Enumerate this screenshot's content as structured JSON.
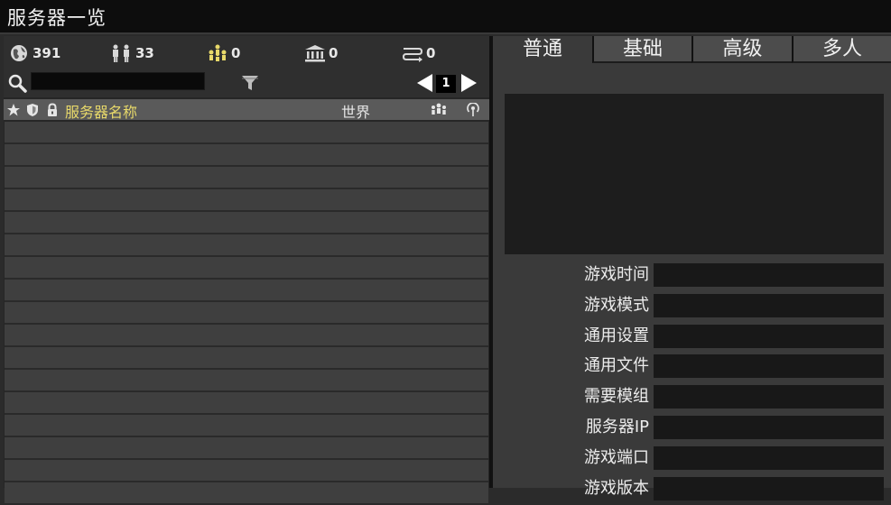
{
  "window": {
    "title": "服务器一览"
  },
  "stats": {
    "worlds": "391",
    "players": "33",
    "groups": "0",
    "buildings": "0",
    "links": "0"
  },
  "search": {
    "value": "",
    "placeholder": ""
  },
  "pager": {
    "page": "1"
  },
  "columns": {
    "name": "服务器名称",
    "world": "世界"
  },
  "server_rows": [
    "",
    "",
    "",
    "",
    "",
    "",
    "",
    "",
    "",
    "",
    "",
    "",
    "",
    "",
    "",
    "",
    ""
  ],
  "tabs": [
    {
      "label": "普通"
    },
    {
      "label": "基础"
    },
    {
      "label": "高级"
    },
    {
      "label": "多人"
    }
  ],
  "info": {
    "rows": [
      {
        "label": "游戏时间",
        "value": ""
      },
      {
        "label": "游戏模式",
        "value": ""
      },
      {
        "label": "通用设置",
        "value": ""
      },
      {
        "label": "通用文件",
        "value": ""
      },
      {
        "label": "需要模组",
        "value": ""
      },
      {
        "label": "服务器IP",
        "value": ""
      },
      {
        "label": "游戏端口",
        "value": ""
      },
      {
        "label": "游戏版本",
        "value": ""
      }
    ]
  },
  "colors": {
    "accent_name": "#e8d96a",
    "bg": "#2b2b2b",
    "row": "#3f3f3f"
  }
}
